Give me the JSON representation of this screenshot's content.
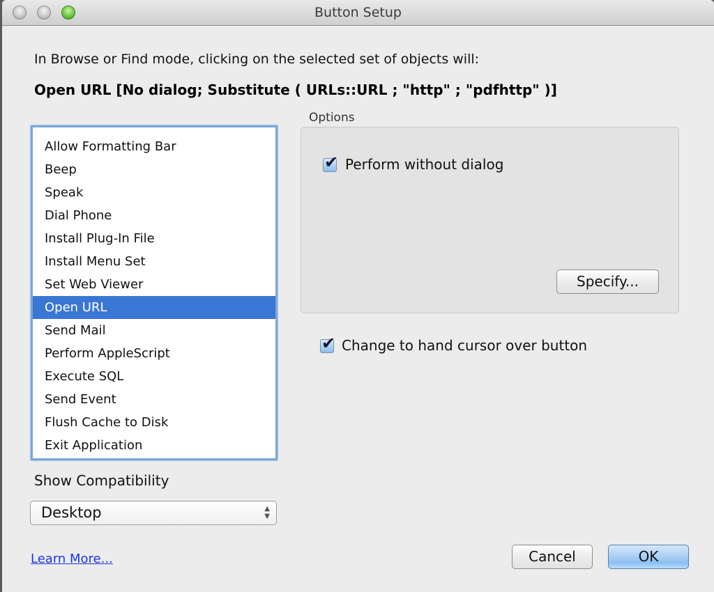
{
  "window": {
    "title": "Button Setup",
    "controls": [
      "close-button",
      "minimize-button",
      "zoom-button"
    ]
  },
  "intro_text": "In Browse or Find mode, clicking on the selected set of objects will:",
  "script_step": "Open URL [No dialog; Substitute ( URLs::URL ; \"http\" ; \"pdfhttp\" )]",
  "action_list": {
    "items": [
      {
        "label": "Allow Formatting Bar",
        "selected": false
      },
      {
        "label": "Beep",
        "selected": false
      },
      {
        "label": "Speak",
        "selected": false
      },
      {
        "label": "Dial Phone",
        "selected": false
      },
      {
        "label": "Install Plug-In File",
        "selected": false
      },
      {
        "label": "Install Menu Set",
        "selected": false
      },
      {
        "label": "Set Web Viewer",
        "selected": false
      },
      {
        "label": "Open URL",
        "selected": true
      },
      {
        "label": "Send Mail",
        "selected": false
      },
      {
        "label": "Perform AppleScript",
        "selected": false
      },
      {
        "label": "Execute SQL",
        "selected": false
      },
      {
        "label": "Send Event",
        "selected": false
      },
      {
        "label": "Flush Cache to Disk",
        "selected": false
      },
      {
        "label": "Exit Application",
        "selected": false
      }
    ],
    "selected_color": "#3a76d3"
  },
  "options": {
    "label": "Options",
    "perform_without_dialog": {
      "label": "Perform without dialog",
      "checked": true
    },
    "specify_button": "Specify..."
  },
  "hand_cursor": {
    "label": "Change to hand cursor over button",
    "checked": true
  },
  "compatibility": {
    "label": "Show Compatibility",
    "selected": "Desktop"
  },
  "learn_more": "Learn More...",
  "buttons": {
    "cancel": "Cancel",
    "ok": "OK"
  },
  "checkmark_glyph": "✔",
  "select_arrows_glyph": "▲▼"
}
